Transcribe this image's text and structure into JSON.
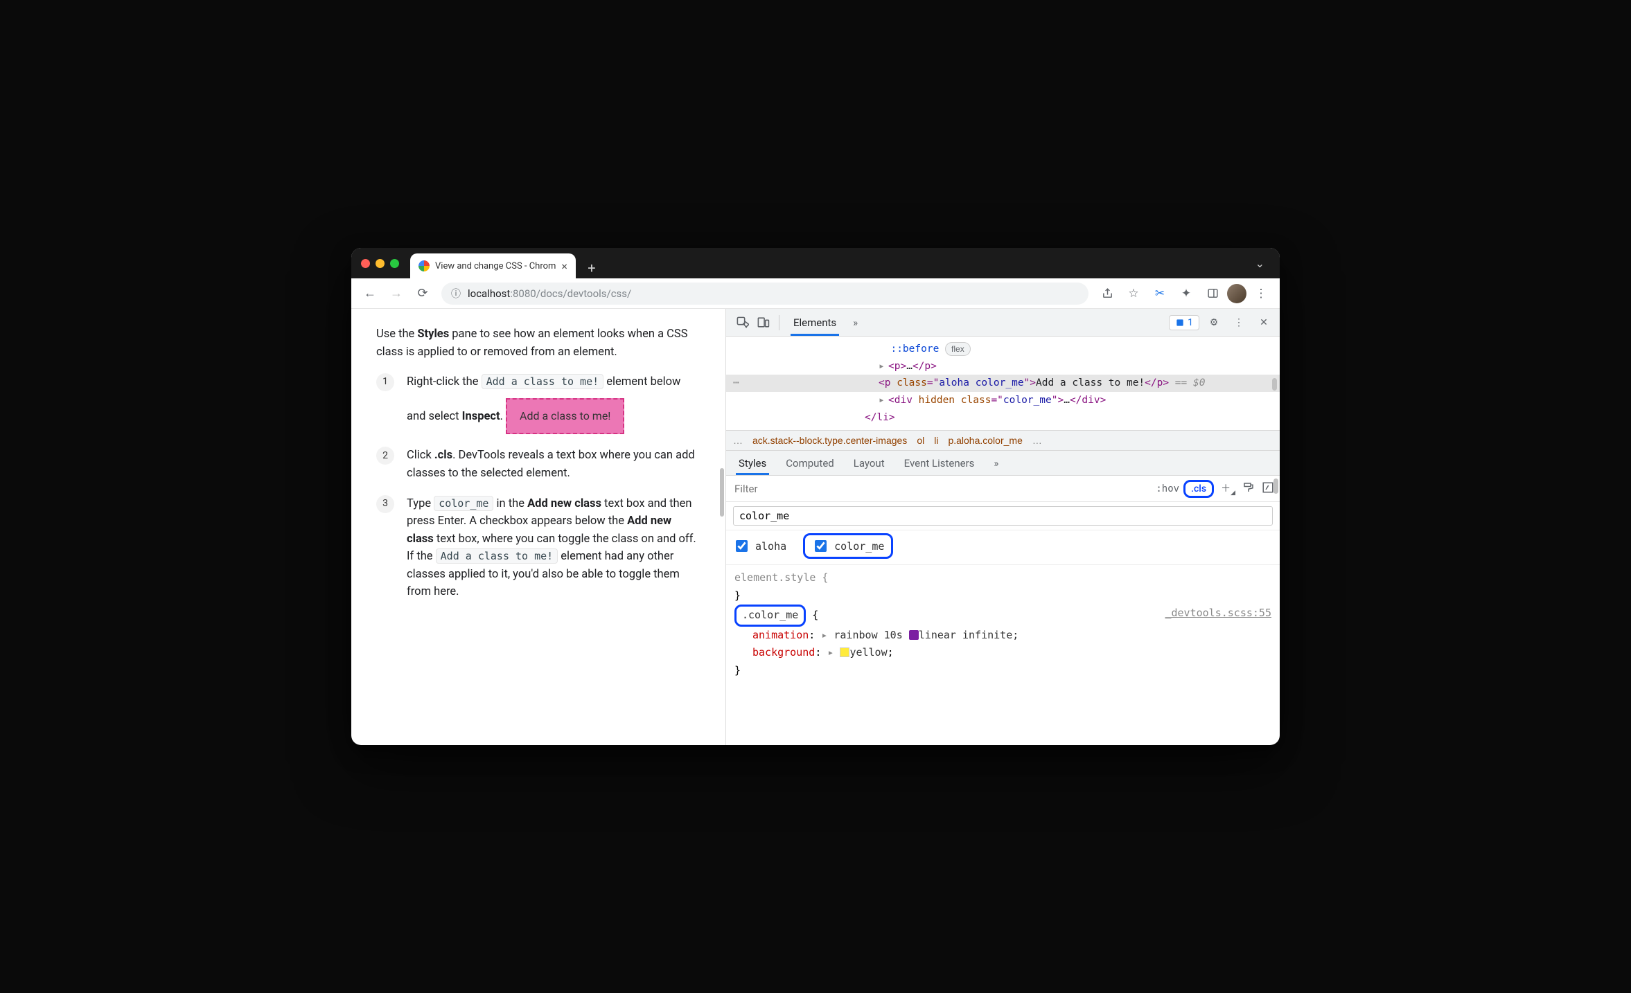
{
  "browser": {
    "tab_title": "View and change CSS - Chrom",
    "url_prefix": "localhost",
    "url_port": ":8080",
    "url_path": "/docs/devtools/css/"
  },
  "page": {
    "intro_pre": "Use the ",
    "intro_bold": "Styles",
    "intro_post": " pane to see how an element looks when a CSS class is applied to or removed from an element.",
    "step1_pre": "Right-click the ",
    "step1_code": "Add a class to me!",
    "step1_mid": " element below and select ",
    "step1_bold": "Inspect",
    "step1_end": ".",
    "demo_box": "Add a class to me!",
    "step2_pre": "Click ",
    "step2_bold": ".cls",
    "step2_post": ". DevTools reveals a text box where you can add classes to the selected element.",
    "step3_pre": "Type ",
    "step3_code": "color_me",
    "step3_mid": " in the ",
    "step3_bold1": "Add new class",
    "step3_mid2": " text box and then press Enter. A checkbox appears below the ",
    "step3_bold2": "Add new class",
    "step3_mid3": " text box, where you can toggle the class on and off. If the ",
    "step3_code2": "Add a class to me!",
    "step3_post": " element had any other classes applied to it, you'd also be able to toggle them from here."
  },
  "devtools": {
    "tab_elements": "Elements",
    "issue_count": "1",
    "dom": {
      "before": "::before",
      "flex_badge": "flex",
      "p_open": "<p>",
      "p_ellipsis": "…",
      "p_close": "</p>",
      "sel_open_prefix": "<p ",
      "sel_attr_name": "class",
      "sel_attr_eq": "=\"",
      "sel_attr_val": "aloha color_me",
      "sel_attr_close": "\">",
      "sel_text": "Add a class to me!",
      "sel_close": "</p>",
      "sel_dollar": " == $0",
      "div_open": "<div ",
      "div_hidden": "hidden",
      "div_sp": " ",
      "div_class_name": "class",
      "div_eq": "=\"",
      "div_class_val": "color_me",
      "div_close_open": "\">",
      "div_ellipsis": "…",
      "div_close": "</div>",
      "li_close": "</li>"
    },
    "breadcrumbs": {
      "more_l": "…",
      "c1": "ack.stack--block.type.center-images",
      "c2": "ol",
      "c3": "li",
      "c4": "p.aloha.color_me",
      "more_r": "…"
    },
    "subtabs": {
      "styles": "Styles",
      "computed": "Computed",
      "layout": "Layout",
      "events": "Event Listeners"
    },
    "styles": {
      "filter_placeholder": "Filter",
      "hov": ":hov",
      "cls": ".cls",
      "class_input": "color_me",
      "toggle1": "aloha",
      "toggle2": "color_me",
      "rule_element": "element.style {",
      "brace_close": "}",
      "rule_color_me": ".color_me",
      "brace_open": " {",
      "source": "_devtools.scss:55",
      "prop1_name": "animation",
      "prop1_val_pre": "rainbow 10s ",
      "prop1_val_post": "linear infinite",
      "prop2_name": "background",
      "prop2_val": "yellow"
    }
  }
}
